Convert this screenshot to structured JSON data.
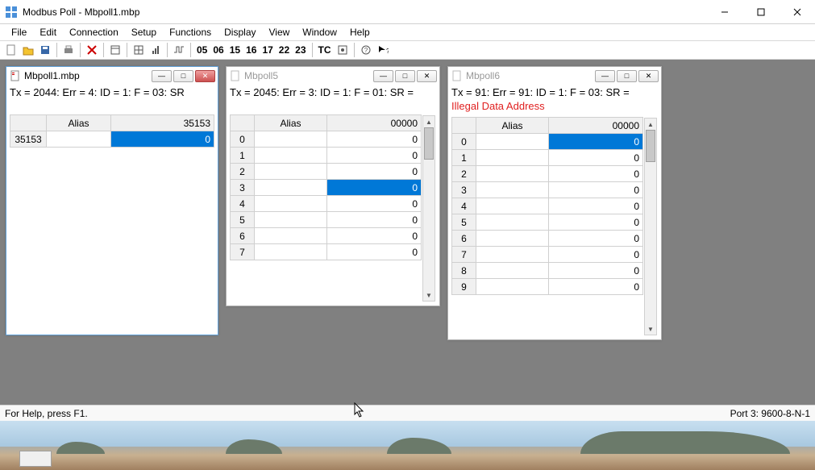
{
  "app": {
    "title": "Modbus Poll - Mbpoll1.mbp"
  },
  "menu": {
    "file": "File",
    "edit": "Edit",
    "connection": "Connection",
    "setup": "Setup",
    "functions": "Functions",
    "display": "Display",
    "view": "View",
    "window": "Window",
    "help": "Help"
  },
  "toolbar": {
    "n05": "05",
    "n06": "06",
    "n15": "15",
    "n16": "16",
    "n17": "17",
    "n22": "22",
    "n23": "23",
    "tc": "TC"
  },
  "windows": {
    "w1": {
      "title": "Mbpoll1.mbp",
      "status": "Tx = 2044: Err = 4: ID = 1: F = 03: SR",
      "col_alias": "Alias",
      "col_val": "35153",
      "rows": [
        {
          "idx": "35153",
          "alias": "",
          "val": "0",
          "sel": true
        }
      ]
    },
    "w2": {
      "title": "Mbpoll5",
      "status": "Tx = 2045: Err = 3: ID = 1: F = 01: SR =",
      "col_alias": "Alias",
      "col_val": "00000",
      "rows": [
        {
          "idx": "0",
          "val": "0"
        },
        {
          "idx": "1",
          "val": "0"
        },
        {
          "idx": "2",
          "val": "0"
        },
        {
          "idx": "3",
          "val": "0",
          "sel": true
        },
        {
          "idx": "4",
          "val": "0"
        },
        {
          "idx": "5",
          "val": "0"
        },
        {
          "idx": "6",
          "val": "0"
        },
        {
          "idx": "7",
          "val": "0"
        }
      ]
    },
    "w3": {
      "title": "Mbpoll6",
      "status": "Tx = 91: Err = 91: ID = 1: F = 03: SR =",
      "error": "Illegal Data Address",
      "col_alias": "Alias",
      "col_val": "00000",
      "rows": [
        {
          "idx": "0",
          "val": "0",
          "sel": true
        },
        {
          "idx": "1",
          "val": "0"
        },
        {
          "idx": "2",
          "val": "0"
        },
        {
          "idx": "3",
          "val": "0"
        },
        {
          "idx": "4",
          "val": "0"
        },
        {
          "idx": "5",
          "val": "0"
        },
        {
          "idx": "6",
          "val": "0"
        },
        {
          "idx": "7",
          "val": "0"
        },
        {
          "idx": "8",
          "val": "0"
        },
        {
          "idx": "9",
          "val": "0"
        }
      ]
    }
  },
  "statusbar": {
    "help": "For Help, press F1.",
    "port": "Port 3: 9600-8-N-1"
  }
}
